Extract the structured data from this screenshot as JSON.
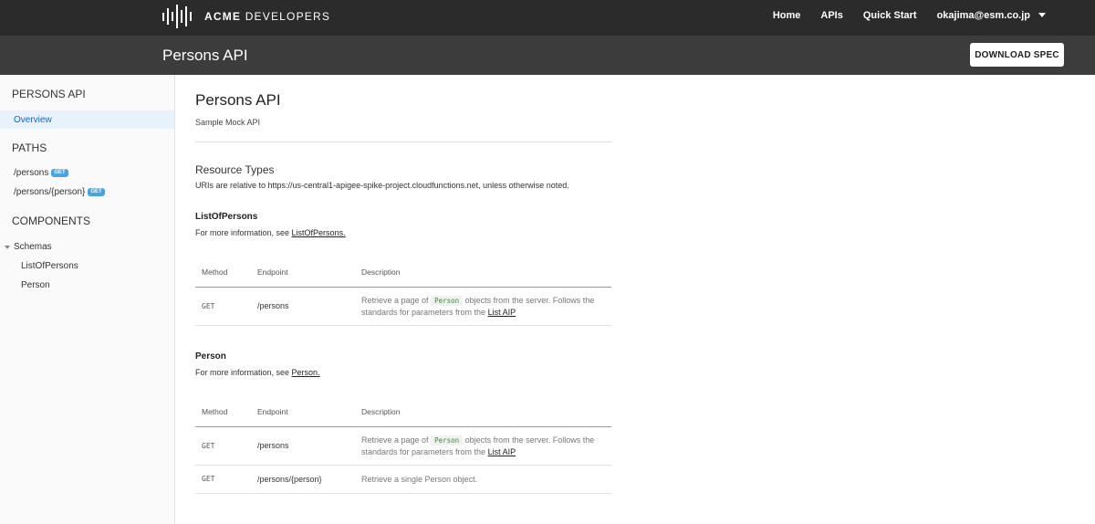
{
  "header": {
    "logo": {
      "prefix": "ACME",
      "suffix": "DEVELOPERS"
    },
    "nav": [
      "Home",
      "APIs",
      "Quick Start"
    ],
    "user": "okajima@esm.co.jp"
  },
  "titlebar": {
    "title": "Persons API",
    "download_label": "DOWNLOAD SPEC"
  },
  "sidebar": {
    "section_api": "PERSONS API",
    "overview": "Overview",
    "section_paths": "PATHS",
    "paths": [
      {
        "label": "/persons",
        "badge": "GET"
      },
      {
        "label": "/persons/{person}",
        "badge": "GET"
      }
    ],
    "section_components": "COMPONENTS",
    "schemas_label": "Schemas",
    "schemas": [
      "ListOfPersons",
      "Person"
    ]
  },
  "main": {
    "title": "Persons API",
    "subtitle": "Sample Mock API",
    "resource_types": "Resource Types",
    "uri_note": "URIs are relative to https://us-central1-apigee-spike-project.cloudfunctions.net, unless otherwise noted.",
    "columns": [
      "Method",
      "Endpoint",
      "Description"
    ],
    "resources": [
      {
        "name": "ListOfPersons",
        "info_prefix": "For more information, see ",
        "info_link": "ListOfPersons.",
        "rows": [
          {
            "method": "GET",
            "endpoint": "/persons",
            "desc_pre": "Retrieve a page of ",
            "desc_code": "Person",
            "desc_mid": " objects from the server. Follows the standards for parameters from the ",
            "desc_link": "List AIP"
          }
        ]
      },
      {
        "name": "Person",
        "info_prefix": "For more information, see ",
        "info_link": "Person.",
        "rows": [
          {
            "method": "GET",
            "endpoint": "/persons",
            "desc_pre": "Retrieve a page of ",
            "desc_code": "Person",
            "desc_mid": " objects from the server. Follows the standards for parameters from the ",
            "desc_link": "List AIP"
          },
          {
            "method": "GET",
            "endpoint": "/persons/{person}",
            "desc_pre": "Retrieve a single Person object."
          }
        ]
      }
    ]
  },
  "colors": {
    "topbar": "#2b2b2b",
    "titlebar": "#3c3c3c",
    "accent": "#1565c0",
    "badge": "#4aa3df"
  }
}
